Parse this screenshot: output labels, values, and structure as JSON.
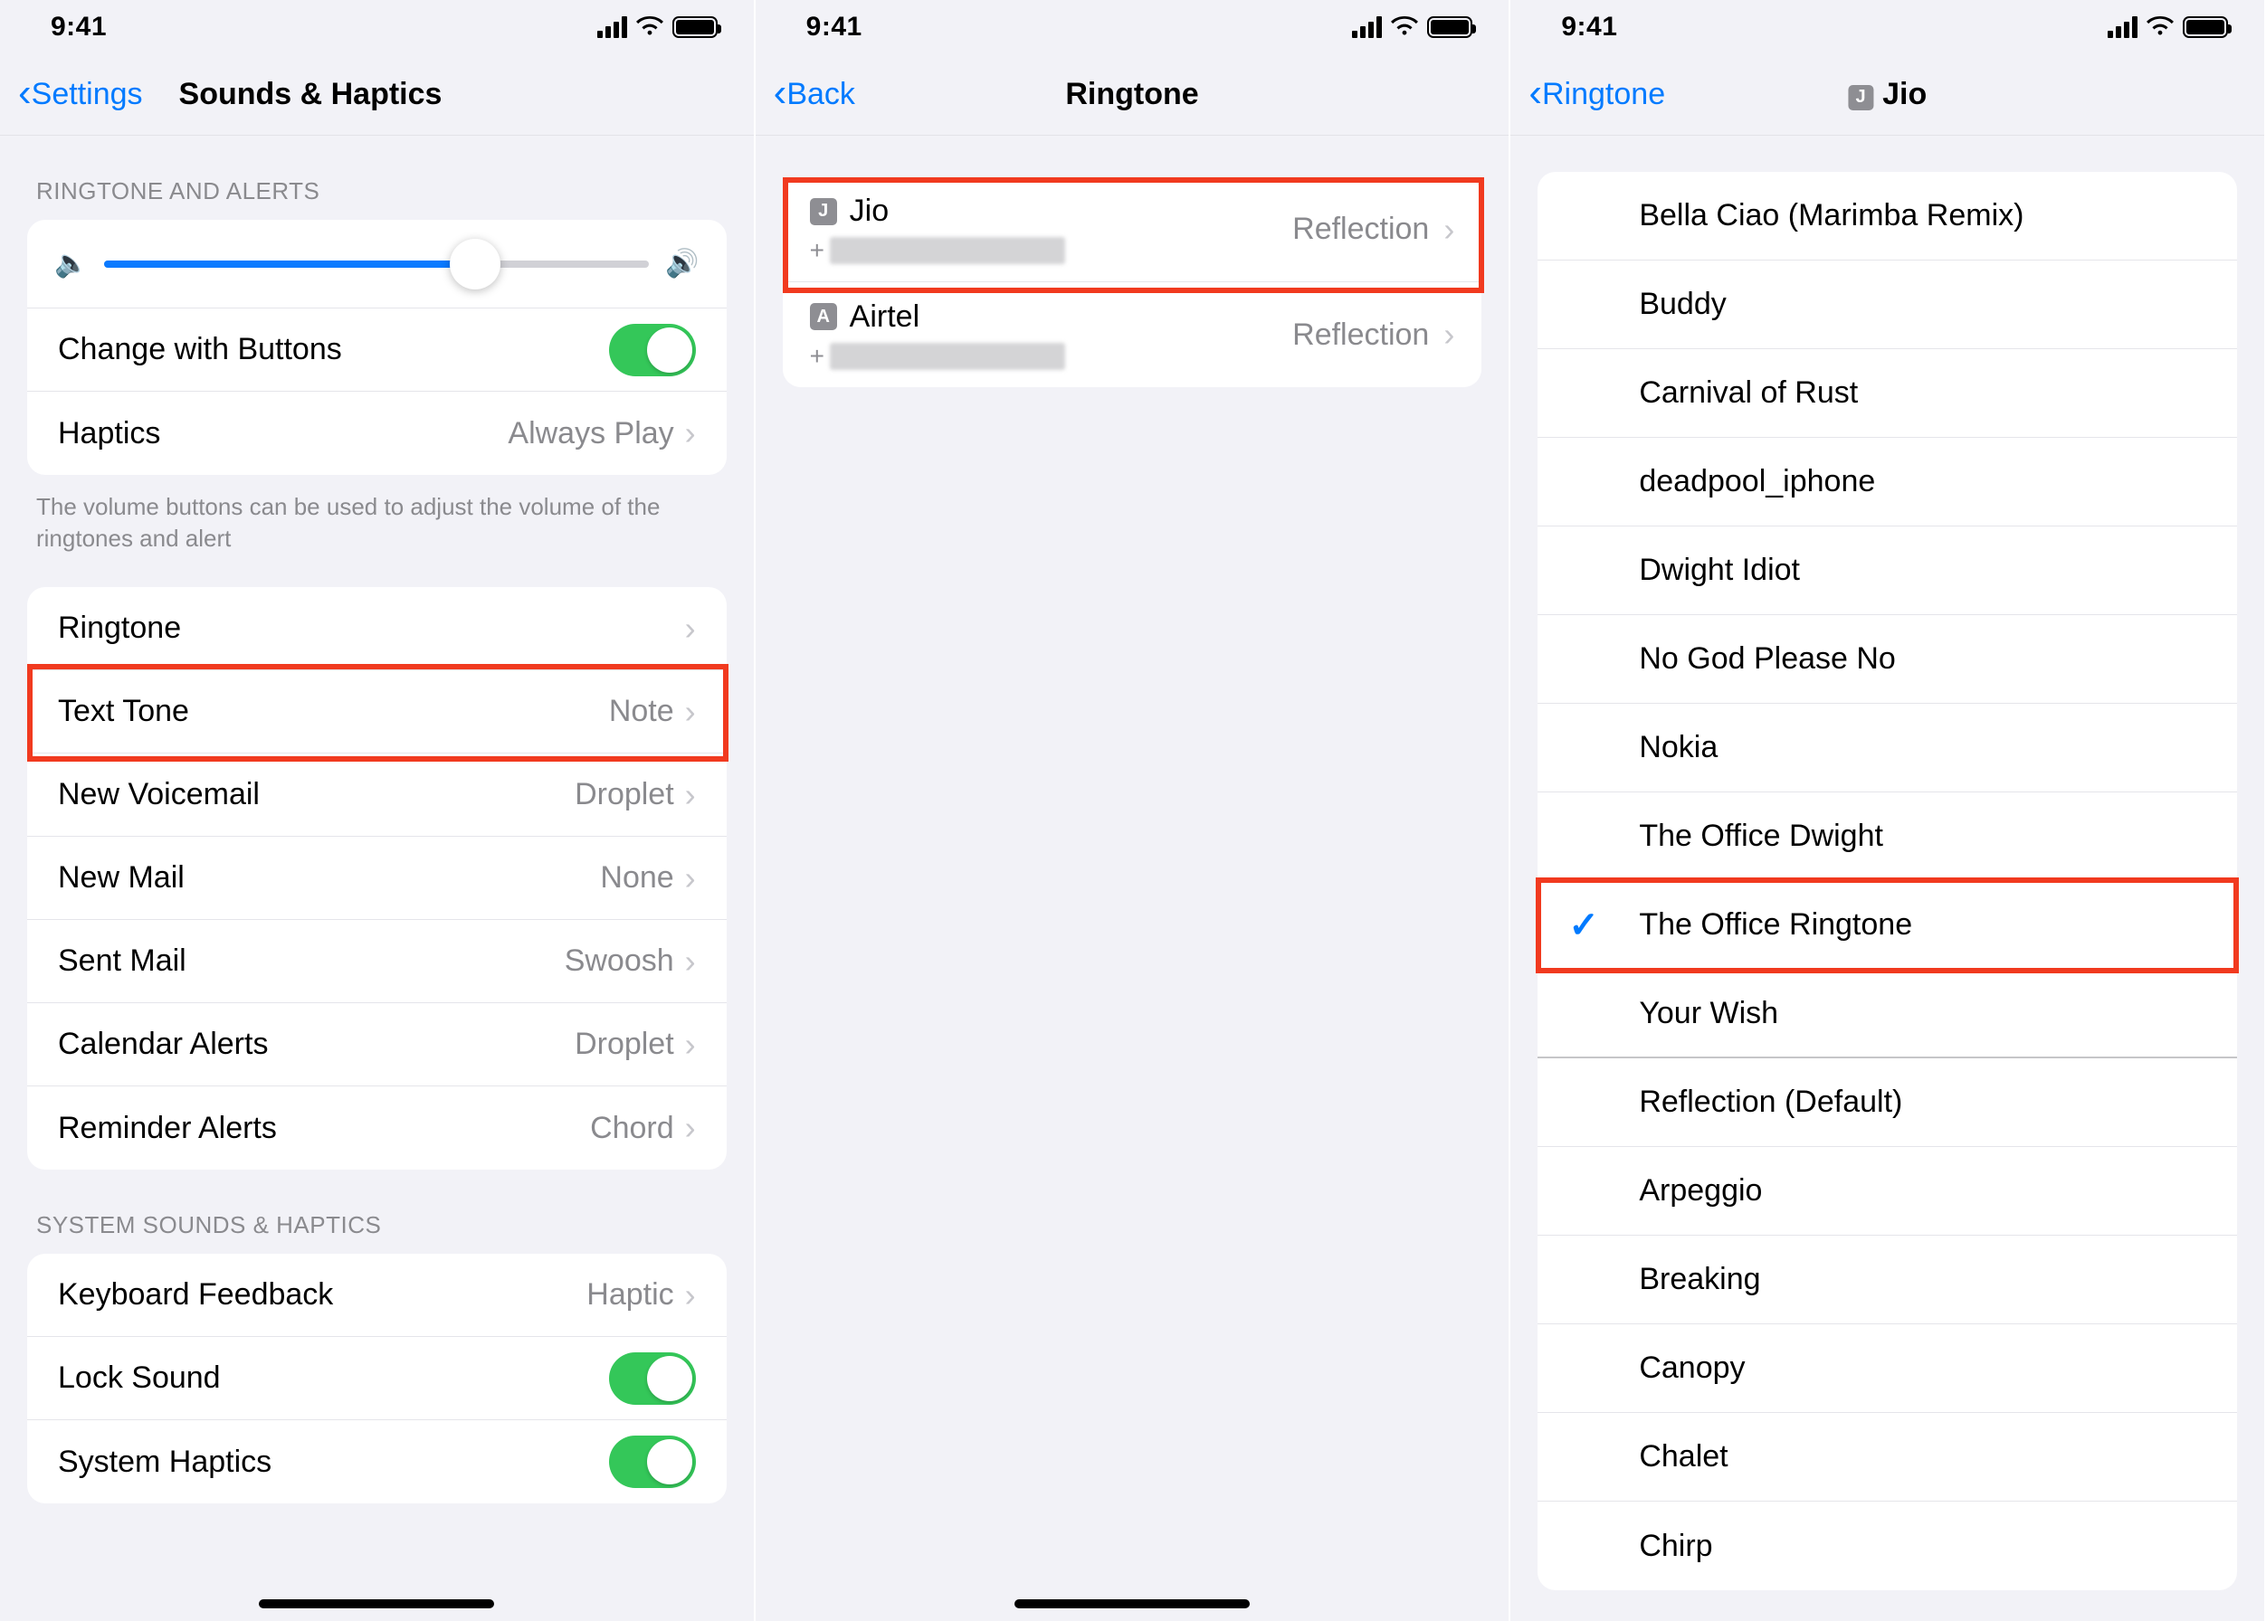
{
  "status": {
    "time": "9:41"
  },
  "screen1": {
    "nav": {
      "back": "Settings",
      "title": "Sounds & Haptics"
    },
    "section1_header": "RINGTONE AND ALERTS",
    "change_with_buttons": "Change with Buttons",
    "haptics_label": "Haptics",
    "haptics_value": "Always Play",
    "footer": "The volume buttons can be used to adjust the volume of the ringtones and alert",
    "sounds": [
      {
        "label": "Ringtone",
        "value": ""
      },
      {
        "label": "Text Tone",
        "value": "Note"
      },
      {
        "label": "New Voicemail",
        "value": "Droplet"
      },
      {
        "label": "New Mail",
        "value": "None"
      },
      {
        "label": "Sent Mail",
        "value": "Swoosh"
      },
      {
        "label": "Calendar Alerts",
        "value": "Droplet"
      },
      {
        "label": "Reminder Alerts",
        "value": "Chord"
      }
    ],
    "section2_header": "SYSTEM SOUNDS & HAPTICS",
    "keyboard_feedback_label": "Keyboard Feedback",
    "keyboard_feedback_value": "Haptic",
    "lock_sound": "Lock Sound",
    "system_haptics": "System Haptics"
  },
  "screen2": {
    "nav": {
      "back": "Back",
      "title": "Ringtone"
    },
    "sims": [
      {
        "badge": "J",
        "name": "Jio",
        "prefix": "+",
        "value": "Reflection"
      },
      {
        "badge": "A",
        "name": "Airtel",
        "prefix": "+",
        "value": "Reflection"
      }
    ]
  },
  "screen3": {
    "nav": {
      "back": "Ringtone",
      "title_badge": "J",
      "title": "Jio"
    },
    "custom_tones": [
      "Bella Ciao (Marimba Remix)",
      "Buddy",
      "Carnival of Rust",
      "deadpool_iphone",
      "Dwight Idiot",
      "No God Please No",
      "Nokia",
      "The Office Dwight",
      "The Office Ringtone",
      "Your Wish"
    ],
    "selected_index": 8,
    "builtin_tones": [
      "Reflection (Default)",
      "Arpeggio",
      "Breaking",
      "Canopy",
      "Chalet",
      "Chirp"
    ]
  }
}
